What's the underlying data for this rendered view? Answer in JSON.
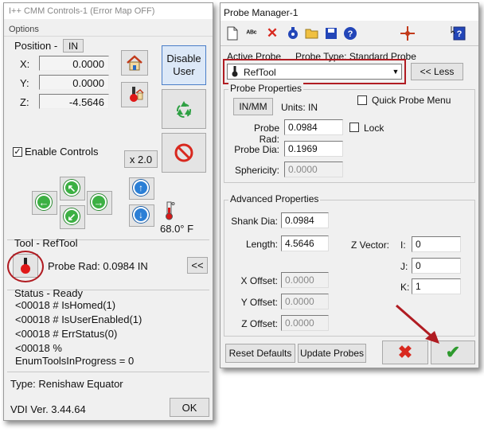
{
  "left": {
    "title": "I++ CMM Controls-1 (Error Map OFF)",
    "menu": "Options",
    "position_label": "Position -",
    "position_unit": "IN",
    "x_label": "X:",
    "x_value": "0.0000",
    "y_label": "Y:",
    "y_value": "0.0000",
    "z_label": "Z:",
    "z_value": "-4.5646",
    "disable_user": "Disable User",
    "enable_controls": "Enable Controls",
    "speed": "x 2.0",
    "temperature": "68.0° F",
    "tool_label": "Tool - RefTool",
    "probe_rad": "Probe Rad: 0.0984 IN",
    "collapse": "<<",
    "status_title": "Status - Ready",
    "status_lines": [
      "<00018 # IsHomed(1)",
      "<00018 # IsUserEnabled(1)",
      "<00018 # ErrStatus(0)",
      "<00018 %",
      "EnumToolsInProgress = 0"
    ],
    "type": "Type: Renishaw Equator",
    "version": "VDI Ver. 3.44.64",
    "ok": "OK"
  },
  "right": {
    "title": "Probe Manager-1",
    "active_probe_label": "Active Probe",
    "probe_type": "Probe Type: Standard Probe",
    "active_probe_value": "RefTool",
    "less": "<< Less",
    "probe_props_title": "Probe Properties",
    "inmm": "IN/MM",
    "units": "Units: IN",
    "quick_menu": "Quick Probe Menu",
    "probe_rad_label": "Probe Rad:",
    "probe_rad_value": "0.0984",
    "lock": "Lock",
    "probe_dia_label": "Probe Dia:",
    "probe_dia_value": "0.1969",
    "sphericity_label": "Sphericity:",
    "sphericity_value": "0.0000",
    "adv_title": "Advanced Properties",
    "shank_label": "Shank Dia:",
    "shank_value": "0.0984",
    "length_label": "Length:",
    "length_value": "4.5646",
    "zvec_label": "Z Vector:",
    "i_label": "I:",
    "i_value": "0",
    "j_label": "J:",
    "j_value": "0",
    "k_label": "K:",
    "k_value": "1",
    "xoff_label": "X Offset:",
    "xoff_value": "0.0000",
    "yoff_label": "Y Offset:",
    "yoff_value": "0.0000",
    "zoff_label": "Z Offset:",
    "zoff_value": "0.0000",
    "reset": "Reset Defaults",
    "update": "Update Probes"
  },
  "colors": {
    "highlight": "#b01c22",
    "accept": "#2e9a2e",
    "cancel": "#d8281e"
  }
}
